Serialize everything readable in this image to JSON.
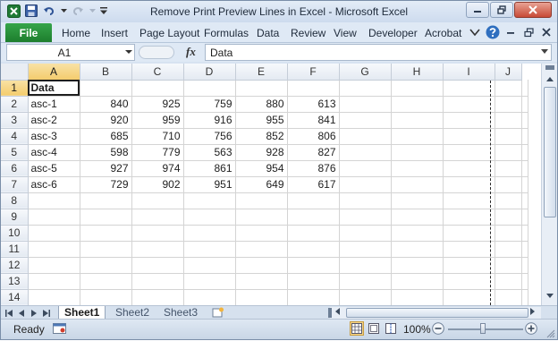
{
  "window": {
    "title": "Remove Print Preview Lines in Excel  -  Microsoft Excel"
  },
  "ribbon": {
    "file_label": "File",
    "tabs": [
      "Home",
      "Insert",
      "Page Layout",
      "Formulas",
      "Data",
      "Review",
      "View",
      "Developer",
      "Acrobat"
    ]
  },
  "formula_bar": {
    "name_box": "A1",
    "fx_label": "fx",
    "formula": "Data"
  },
  "sheet": {
    "columns": [
      "A",
      "B",
      "C",
      "D",
      "E",
      "F",
      "G",
      "H",
      "I",
      "J"
    ],
    "row_numbers": [
      "1",
      "2",
      "3",
      "4",
      "5",
      "6",
      "7",
      "8",
      "9",
      "10",
      "11",
      "12",
      "13",
      "14"
    ],
    "active_cell": "A1",
    "rows": [
      [
        "Data",
        "",
        "",
        "",
        "",
        "",
        "",
        "",
        "",
        ""
      ],
      [
        "asc-1",
        "840",
        "925",
        "759",
        "880",
        "613",
        "",
        "",
        "",
        ""
      ],
      [
        "asc-2",
        "920",
        "959",
        "916",
        "955",
        "841",
        "",
        "",
        "",
        ""
      ],
      [
        "asc-3",
        "685",
        "710",
        "756",
        "852",
        "806",
        "",
        "",
        "",
        ""
      ],
      [
        "asc-4",
        "598",
        "779",
        "563",
        "928",
        "827",
        "",
        "",
        "",
        ""
      ],
      [
        "asc-5",
        "927",
        "974",
        "861",
        "954",
        "876",
        "",
        "",
        "",
        ""
      ],
      [
        "asc-6",
        "729",
        "902",
        "951",
        "649",
        "617",
        "",
        "",
        "",
        ""
      ],
      [
        "",
        "",
        "",
        "",
        "",
        "",
        "",
        "",
        "",
        ""
      ],
      [
        "",
        "",
        "",
        "",
        "",
        "",
        "",
        "",
        "",
        ""
      ],
      [
        "",
        "",
        "",
        "",
        "",
        "",
        "",
        "",
        "",
        ""
      ],
      [
        "",
        "",
        "",
        "",
        "",
        "",
        "",
        "",
        "",
        ""
      ],
      [
        "",
        "",
        "",
        "",
        "",
        "",
        "",
        "",
        "",
        ""
      ],
      [
        "",
        "",
        "",
        "",
        "",
        "",
        "",
        "",
        "",
        ""
      ],
      [
        "",
        "",
        "",
        "",
        "",
        "",
        "",
        "",
        "",
        ""
      ]
    ]
  },
  "sheet_tabs": {
    "tabs": [
      "Sheet1",
      "Sheet2",
      "Sheet3"
    ],
    "active": "Sheet1"
  },
  "status": {
    "ready": "Ready",
    "zoom": "100%"
  },
  "colors": {
    "file_tab": "#2a9140",
    "selected_header": "#f4cc6d",
    "close_button": "#c84a36"
  }
}
